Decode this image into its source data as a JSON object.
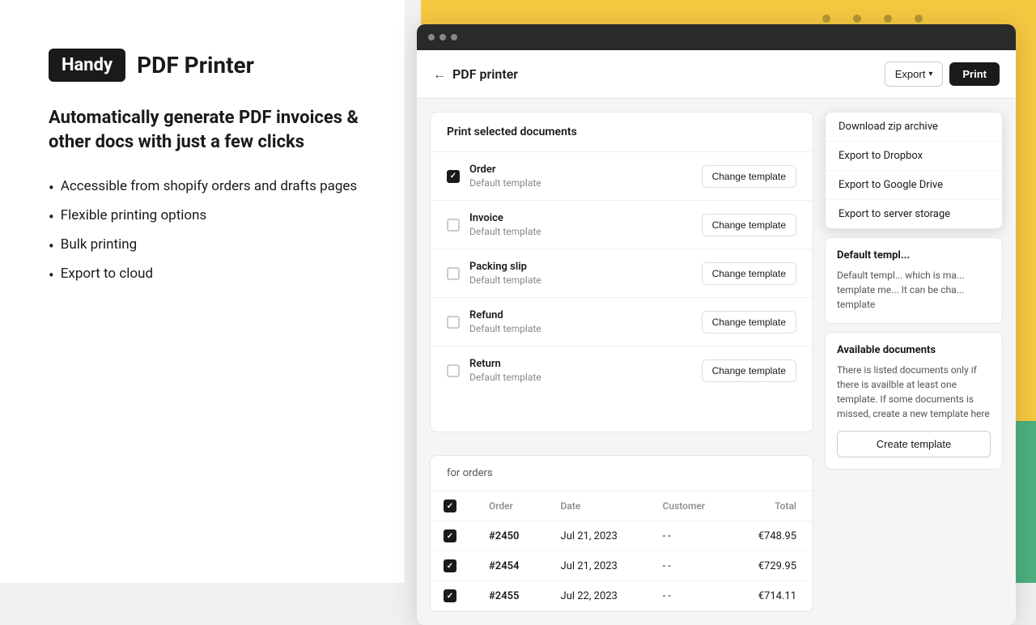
{
  "background": {
    "yellow_visible": true,
    "green_visible": true
  },
  "marketing": {
    "logo_label": "Handy",
    "product_name": "PDF Printer",
    "tagline": "Automatically generate PDF invoices & other docs with just a few clicks",
    "bullets": [
      "Accessible from shopify orders and drafts pages",
      "Flexible printing options",
      "Bulk printing",
      "Export to cloud"
    ]
  },
  "browser": {
    "dots": [
      "",
      "",
      ""
    ]
  },
  "header": {
    "back_label": "←",
    "title": "PDF printer",
    "export_label": "Export",
    "chevron": "▾",
    "print_label": "Print"
  },
  "documents_card": {
    "title": "Print selected documents",
    "rows": [
      {
        "name": "Order",
        "template": "Default template",
        "checked": true
      },
      {
        "name": "Invoice",
        "template": "Default template",
        "checked": false
      },
      {
        "name": "Packing slip",
        "template": "Default template",
        "checked": false
      },
      {
        "name": "Refund",
        "template": "Default template",
        "checked": false
      },
      {
        "name": "Return",
        "template": "Default template",
        "checked": false
      }
    ],
    "change_template_label": "Change template"
  },
  "dropdown": {
    "items": [
      "Download zip archive",
      "Export to Dropbox",
      "Export to Google Drive",
      "Export to server storage"
    ]
  },
  "default_template_card": {
    "title": "Default templ...",
    "text": "Default templ... which is ma... template me... It can be cha... template"
  },
  "available_docs_card": {
    "title": "Available documents",
    "text": "There is listed documents only if there is availble at least one template. If some documents is missed, create a new template here",
    "create_button": "Create template"
  },
  "orders_section": {
    "label": "for orders",
    "columns": [
      "Order",
      "Date",
      "Customer",
      "Total"
    ],
    "rows": [
      {
        "order": "#2450",
        "date": "Jul 21, 2023",
        "customer": "- -",
        "total": "€748.95",
        "checked": true
      },
      {
        "order": "#2454",
        "date": "Jul 21, 2023",
        "customer": "- -",
        "total": "€729.95",
        "checked": true
      },
      {
        "order": "#2455",
        "date": "Jul 22, 2023",
        "customer": "- -",
        "total": "€714.11",
        "checked": true
      }
    ]
  }
}
